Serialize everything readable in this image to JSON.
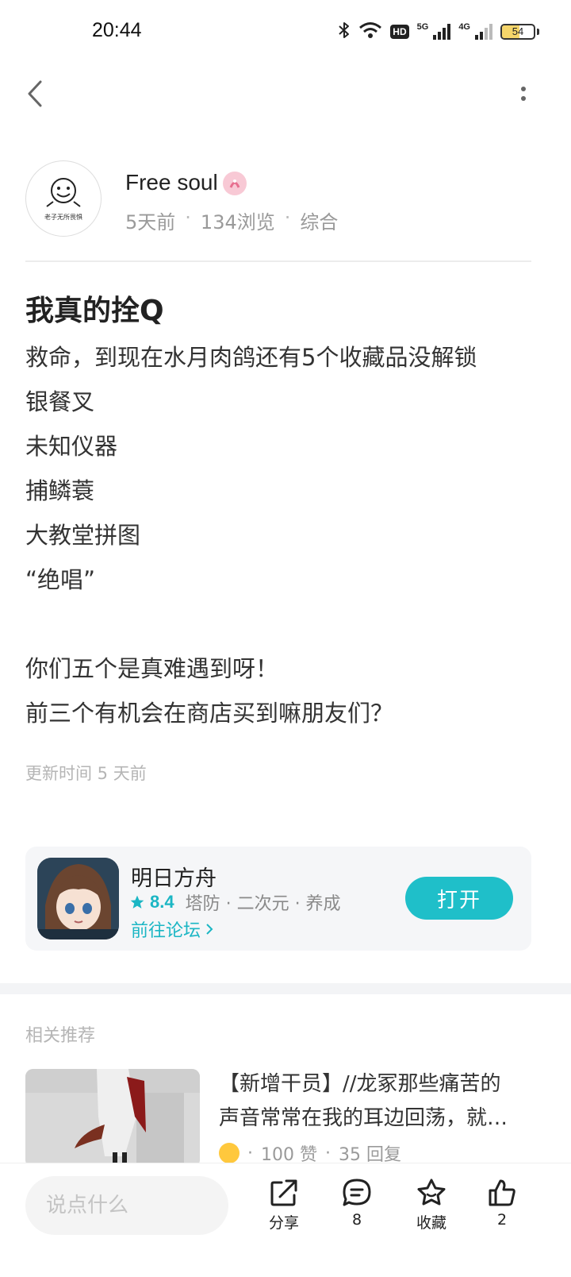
{
  "status_bar": {
    "time": "20:44",
    "network_5g": "5G",
    "network_4g": "4G",
    "hd_label": "HD",
    "battery_percent": "54",
    "battery_level": 0.54
  },
  "author": {
    "avatar_caption": "老子无所畏惧",
    "name": "Free soul",
    "time_ago": "5天前",
    "views": "134浏览",
    "category": "综合"
  },
  "post": {
    "title": "我真的拴Q",
    "lines": [
      "救命，到现在水月肉鸽还有5个收藏品没解锁",
      "银餐叉",
      "未知仪器",
      "捕鳞蓑",
      "大教堂拼图",
      "“绝唱”",
      "",
      "你们五个是真难遇到呀！",
      "前三个有机会在商店买到嘛朋友们？"
    ],
    "updated": "更新时间 5 天前"
  },
  "game_card": {
    "name": "明日方舟",
    "rating": "8.4",
    "tags": "塔防 · 二次元 · 养成",
    "forum_link": "前往论坛",
    "open_label": "打开",
    "accent_color": "#1fbfc9"
  },
  "related": {
    "heading": "相关推荐",
    "items": [
      {
        "title_line1": "【新增干员】//龙冢那些痛苦的",
        "title_line2": "声音常常在我的耳边回荡，就…",
        "likes": "100 赞",
        "replies": "35 回复"
      }
    ]
  },
  "bottom_bar": {
    "comment_placeholder": "说点什么",
    "share_label": "分享",
    "comments_count": "8",
    "favorite_label": "收藏",
    "likes_count": "2"
  }
}
